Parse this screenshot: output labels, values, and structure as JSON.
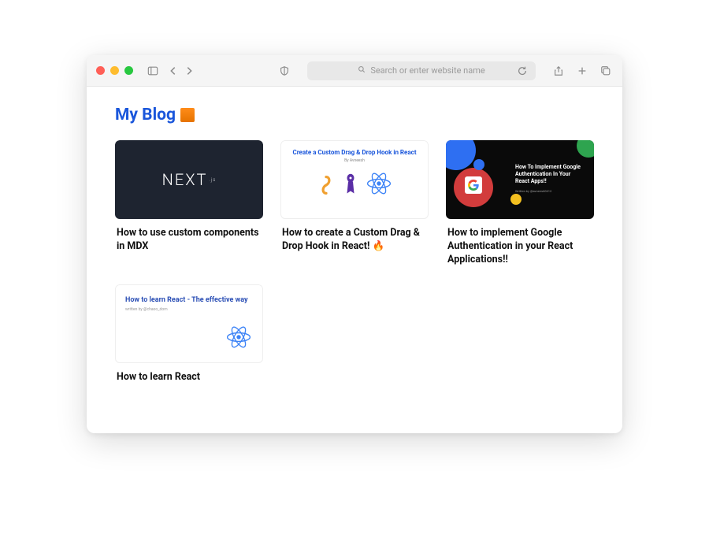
{
  "browser": {
    "search_placeholder": "Search or enter website name"
  },
  "page": {
    "title": "My Blog"
  },
  "posts": [
    {
      "title": "How to use custom components in MDX",
      "thumb_type": "nextjs",
      "thumb_text": "NEXT",
      "thumb_sub": ".js"
    },
    {
      "title": "How to create a Custom Drag & Drop Hook in React! 🔥",
      "thumb_type": "dragdrop",
      "thumb_title": "Create a Custom Drag & Drop Hook in React",
      "thumb_sub": "By Avneesh"
    },
    {
      "title": "How to implement Google Authentication in your React Applications!!",
      "thumb_type": "google",
      "thumb_title": "How To Implement Google Authentication In Your React Apps!!",
      "thumb_sub": "Written by   @avneesh0612"
    },
    {
      "title": "How to learn React",
      "thumb_type": "learn",
      "thumb_title": "How to learn React - The effective way",
      "thumb_sub": "written by @chaoo_dom"
    }
  ]
}
